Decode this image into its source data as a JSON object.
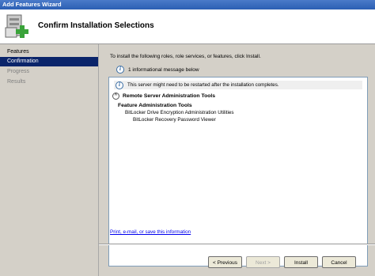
{
  "window": {
    "title": "Add Features Wizard"
  },
  "header": {
    "title": "Confirm Installation Selections",
    "icon": "add-features-icon"
  },
  "sidebar": {
    "items": [
      {
        "label": "Features",
        "state": "done"
      },
      {
        "label": "Confirmation",
        "state": "active"
      },
      {
        "label": "Progress",
        "state": "inactive"
      },
      {
        "label": "Results",
        "state": "inactive"
      }
    ]
  },
  "main": {
    "instruction": "To install the following roles, role services, or features, click Install.",
    "info_count": "1 informational message below",
    "message": "This server might need to be restarted after the installation completes.",
    "section_title": "Remote Server Administration Tools",
    "feature_group": "Feature Administration Tools",
    "feature_item": "BitLocker Drive Encryption Administration Utilities",
    "feature_subitem": "BitLocker Recovery Password Viewer",
    "link": "Print, e-mail, or save this information"
  },
  "buttons": {
    "previous": "< Previous",
    "next": "Next >",
    "install": "Install",
    "cancel": "Cancel"
  },
  "colors": {
    "selection": "#0a246a",
    "titlebar": "#2b5fb3",
    "link": "#0000ee"
  }
}
